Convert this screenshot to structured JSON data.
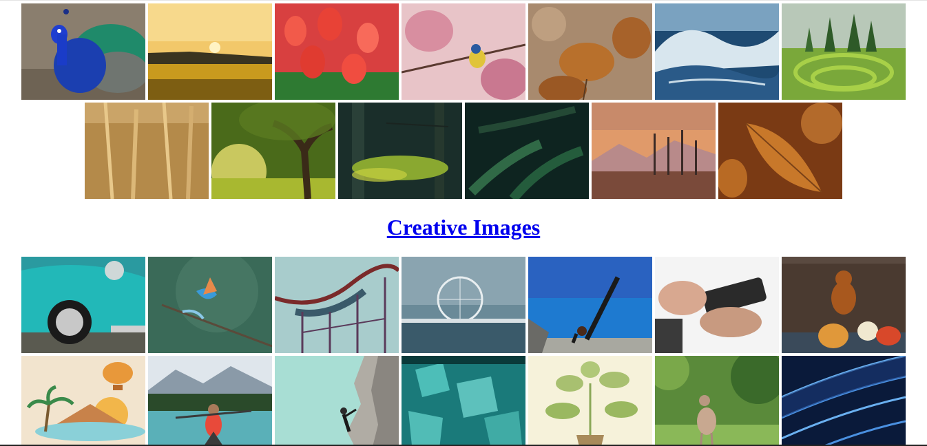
{
  "section": {
    "heading": "Creative Images"
  },
  "gallery": {
    "nature_row_1": [
      {
        "name": "peacock"
      },
      {
        "name": "sunflower-sunset"
      },
      {
        "name": "red-tulips"
      },
      {
        "name": "bird-blossom"
      },
      {
        "name": "dried-hydrangea"
      },
      {
        "name": "ocean-wave"
      },
      {
        "name": "hedge-maze"
      }
    ],
    "nature_row_2": [
      {
        "name": "wheat"
      },
      {
        "name": "sunlit-tree"
      },
      {
        "name": "forest-bokeh"
      },
      {
        "name": "pine-branches"
      },
      {
        "name": "lake-sunset"
      },
      {
        "name": "autumn-leaf"
      }
    ],
    "creative_row_1": [
      {
        "name": "vintage-teal-car"
      },
      {
        "name": "kingfisher-flight"
      },
      {
        "name": "roller-coaster"
      },
      {
        "name": "ferris-wheel-harbor"
      },
      {
        "name": "yoga-beach"
      },
      {
        "name": "camera-hands"
      },
      {
        "name": "dachshund-pumpkins"
      }
    ],
    "creative_row_2": [
      {
        "name": "beach-illustration"
      },
      {
        "name": "kayak-lake"
      },
      {
        "name": "climber-illustration"
      },
      {
        "name": "teal-crystals"
      },
      {
        "name": "plant-illustration"
      },
      {
        "name": "deer-meadow"
      },
      {
        "name": "blue-architecture"
      }
    ]
  }
}
